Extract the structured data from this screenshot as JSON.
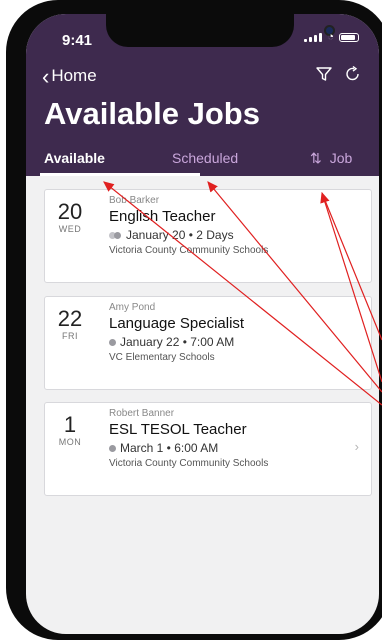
{
  "status": {
    "time": "9:41"
  },
  "header": {
    "back_label": "Home",
    "title": "Available Jobs",
    "filter_icon": "filter-icon",
    "refresh_icon": "refresh-icon"
  },
  "tabs": [
    {
      "label": "Available",
      "active": true
    },
    {
      "label": "Scheduled",
      "active": false
    },
    {
      "label": "Job",
      "icon": "sort-icon"
    }
  ],
  "jobs": [
    {
      "day": "20",
      "weekday": "WED",
      "name": "Bob Barker",
      "title": "English Teacher",
      "when": "January 20 • 2 Days",
      "school": "Victoria County Community Schools"
    },
    {
      "day": "22",
      "weekday": "FRI",
      "name": "Amy Pond",
      "title": "Language Specialist",
      "when": "January 22 • 7:00 AM",
      "school": "VC Elementary Schools"
    },
    {
      "day": "1",
      "weekday": "MON",
      "name": "Robert Banner",
      "title": "ESL TESOL Teacher",
      "when": "March 1 • 6:00 AM",
      "school": "Victoria County Community Schools"
    }
  ],
  "colors": {
    "header": "#3e2a4e",
    "tab_inactive": "#c9a6db",
    "arrow": "#e02020"
  }
}
